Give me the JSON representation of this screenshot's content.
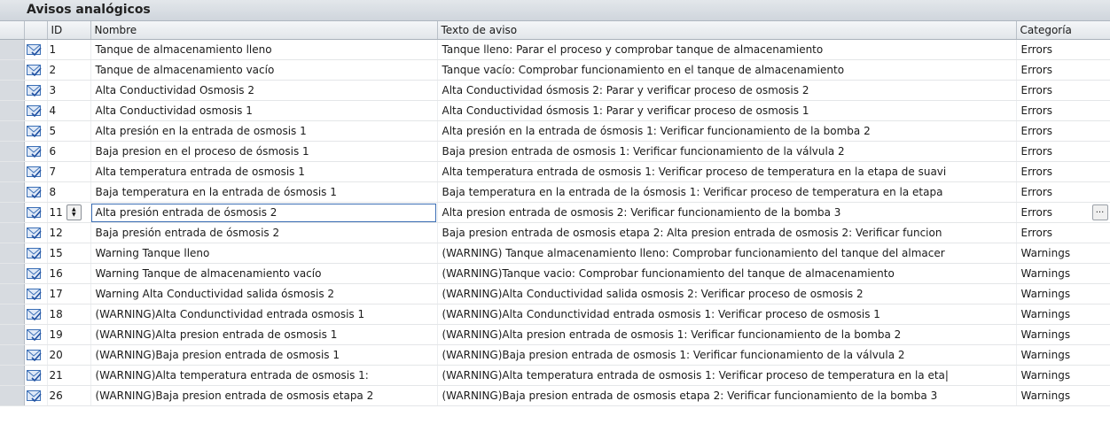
{
  "panel": {
    "title": "Avisos analógicos"
  },
  "columns": {
    "id": "ID",
    "name": "Nombre",
    "text": "Texto de aviso",
    "category": "Categoría"
  },
  "editing_row_index": 8,
  "row_icon": "envelope-checkmark-icon",
  "rows": [
    {
      "id": "1",
      "name": "Tanque de almacenamiento lleno",
      "text": "Tanque lleno: Parar el proceso y  comprobar tanque de almacenamiento",
      "category": "Errors"
    },
    {
      "id": "2",
      "name": "Tanque de almacenamiento vacío",
      "text": "Tanque vacío: Comprobar funcionamiento en el tanque de almacenamiento",
      "category": "Errors"
    },
    {
      "id": "3",
      "name": "Alta Conductividad Osmosis 2",
      "text": "Alta Conductividad ósmosis 2: Parar y verificar proceso de osmosis 2",
      "category": "Errors"
    },
    {
      "id": "4",
      "name": "Alta Conductividad osmosis 1",
      "text": "Alta Conductividad ósmosis 1: Parar  y  verificar proceso de osmosis 1",
      "category": "Errors"
    },
    {
      "id": "5",
      "name": "Alta presión en la entrada de osmosis 1",
      "text": "Alta presión en la entrada de ósmosis 1: Verificar funcionamiento de la bomba 2",
      "category": "Errors"
    },
    {
      "id": "6",
      "name": "Baja presion en el proceso de ósmosis 1",
      "text": "Baja  presion entrada de osmosis 1: Verificar funcionamiento de la válvula 2",
      "category": "Errors"
    },
    {
      "id": "7",
      "name": "Alta temperatura entrada de osmosis 1",
      "text": "Alta temperatura entrada de osmosis 1: Verificar proceso de temperatura en la etapa de suavi",
      "category": "Errors"
    },
    {
      "id": "8",
      "name": "Baja temperatura en la entrada de ósmosis 1",
      "text": "Baja temperatura en la entrada de la ósmosis 1: Verificar proceso de temperatura en la etapa",
      "category": "Errors"
    },
    {
      "id": "11",
      "name": "Alta presión entrada de ósmosis 2",
      "text": "Alta presion entrada de osmosis 2: Verificar funcionamiento de la bomba 3",
      "category": "Errors"
    },
    {
      "id": "12",
      "name": "Baja presión entrada de ósmosis 2",
      "text": "Baja  presion entrada de osmosis etapa 2: Alta presion entrada de osmosis 2: Verificar funcion",
      "category": "Errors"
    },
    {
      "id": "15",
      "name": "Warning Tanque lleno",
      "text": "(WARNING) Tanque almacenamiento lleno: Comprobar funcionamiento del tanque del almacer",
      "category": "Warnings"
    },
    {
      "id": "16",
      "name": "Warning Tanque de almacenamiento vacío",
      "text": "(WARNING)Tanque vacio: Comprobar funcionamiento del tanque de almacenamiento",
      "category": "Warnings"
    },
    {
      "id": "17",
      "name": "Warning Alta Conductividad salida  ósmosis 2",
      "text": "(WARNING)Alta Conductividad salida osmosis 2: Verificar proceso de osmosis 2",
      "category": "Warnings"
    },
    {
      "id": "18",
      "name": "(WARNING)Alta Cond­unctividad entrada osmosis 1",
      "text": "(WARNING)Alta Cond­unctividad entrada osmosis 1:  Verificar proceso de osmosis 1",
      "category": "Warnings"
    },
    {
      "id": "19",
      "name": "(WARNING)Alta presion entrada de osmosis 1",
      "text": "(WARNING)Alta presion entrada de osmosis 1: Verificar funcionamiento de la bomba 2",
      "category": "Warnings"
    },
    {
      "id": "20",
      "name": "(WARNING)Baja  presion entrada de osmosis 1",
      "text": "(WARNING)Baja  presion entrada de osmosis 1: Verificar funcionamiento de la válvula 2",
      "category": "Warnings"
    },
    {
      "id": "21",
      "name": "(WARNING)Alta temperatura entrada de osmosis 1:",
      "text": "(WARNING)Alta temperatura entrada de osmosis 1:  Verificar proceso de temperatura en la eta|",
      "category": "Warnings"
    },
    {
      "id": "26",
      "name": "(WARNING)Baja  presion entrada de osmosis etapa 2",
      "text": "(WARNING)Baja  presion entrada de osmosis etapa 2:  Verificar funcionamiento de la bomba 3",
      "category": "Warnings"
    }
  ]
}
